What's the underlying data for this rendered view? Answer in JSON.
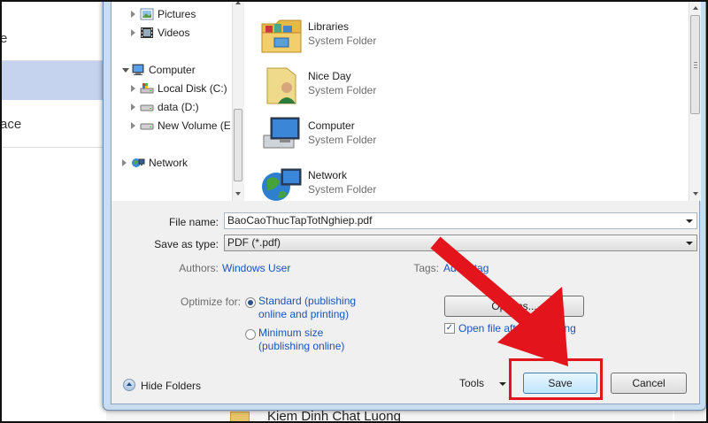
{
  "background": {
    "items": [
      {
        "label": "e",
        "selected": false
      },
      {
        "label": "",
        "selected": true
      },
      {
        "label": "ace",
        "selected": false
      }
    ],
    "bottom_text": "Kiem Dinh Chat Luong"
  },
  "nav": {
    "items": [
      {
        "label": "Pictures",
        "icon": "pictures-icon",
        "expander": "right"
      },
      {
        "label": "Videos",
        "icon": "videos-icon",
        "expander": "right"
      },
      {
        "label": "Computer",
        "icon": "computer-icon",
        "expander": "down"
      },
      {
        "label": "Local Disk (C:)",
        "icon": "local-disk-icon",
        "expander": "right"
      },
      {
        "label": "data (D:)",
        "icon": "drive-icon",
        "expander": "right"
      },
      {
        "label": "New Volume (E",
        "icon": "drive-icon",
        "expander": "right"
      },
      {
        "label": "Network",
        "icon": "network-icon",
        "expander": "right"
      }
    ]
  },
  "files": [
    {
      "name": "Libraries",
      "type": "System Folder",
      "icon": "libraries-icon"
    },
    {
      "name": "Nice Day",
      "type": "System Folder",
      "icon": "user-folder-icon"
    },
    {
      "name": "Computer",
      "type": "System Folder",
      "icon": "computer-icon"
    },
    {
      "name": "Network",
      "type": "System Folder",
      "icon": "network-icon"
    }
  ],
  "form": {
    "file_name_label": "File name:",
    "file_name_value": "BaoCaoThucTapTotNghiep.pdf",
    "save_as_type_label": "Save as type:",
    "save_as_type_value": "PDF (*.pdf)",
    "authors_label": "Authors:",
    "authors_value": "Windows User",
    "tags_label": "Tags:",
    "tags_value": "Add a tag",
    "optimize_label": "Optimize for:",
    "optimize_standard_1": "Standard (publishing",
    "optimize_standard_2": "online and printing)",
    "optimize_minimum_1": "Minimum size",
    "optimize_minimum_2": "(publishing online)",
    "options_button": "Options...",
    "open_after_label": "Open file after publishing",
    "hide_folders": "Hide Folders",
    "tools_label": "Tools",
    "save_button": "Save",
    "cancel_button": "Cancel"
  },
  "colors": {
    "annotation_red": "#e3141b",
    "link_blue": "#1a55b8"
  }
}
